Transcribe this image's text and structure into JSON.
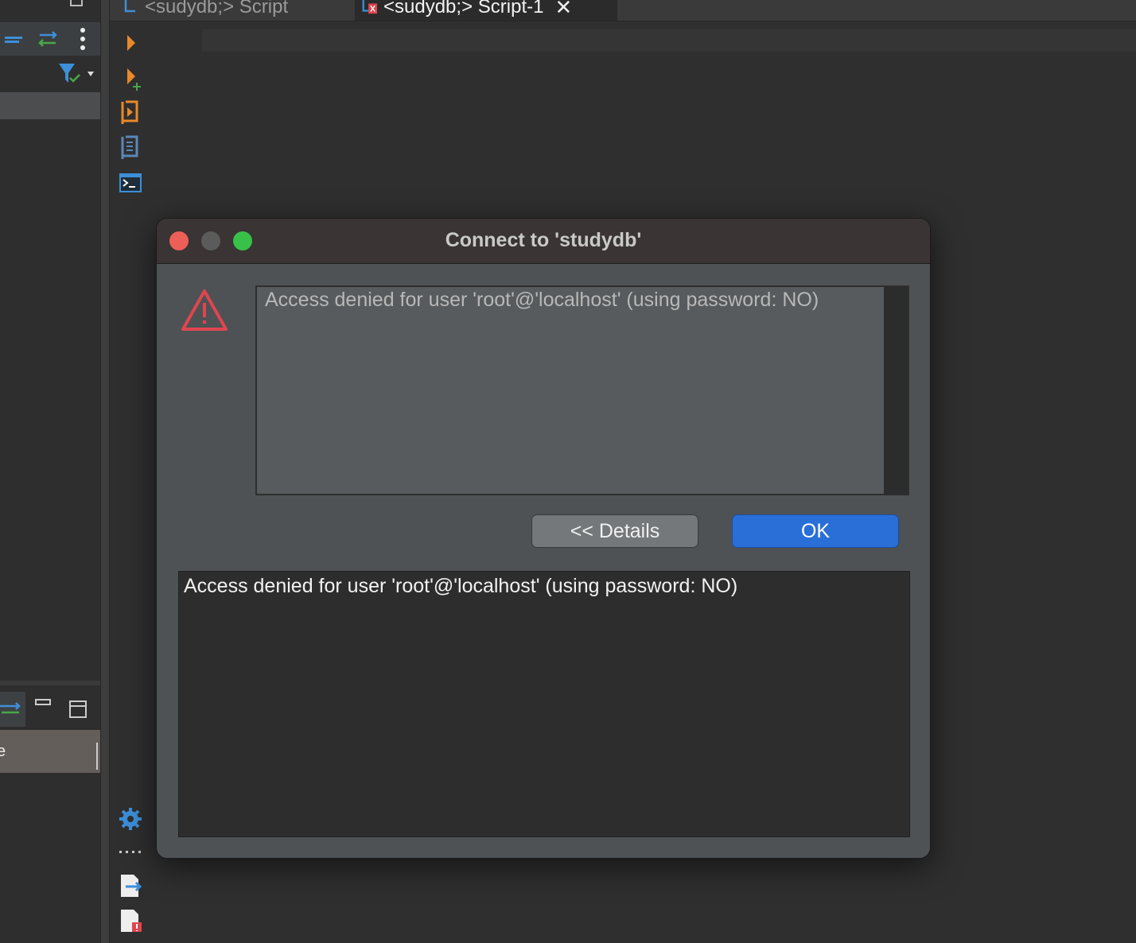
{
  "tabs": [
    {
      "label": "<sudydb;> Script",
      "active": false
    },
    {
      "label": "<sudydb;> Script-1",
      "active": true
    }
  ],
  "dialog": {
    "title": "Connect to 'studydb'",
    "message": "Access denied for user 'root'@'localhost' (using password: NO)",
    "details_button": "<< Details",
    "ok_button": "OK",
    "details_text": "Access denied for user 'root'@'localhost' (using password: NO)"
  },
  "left_panel": {
    "bottom_row_text": "e"
  },
  "icons": {
    "gutter": [
      "execute-statement-icon",
      "execute-in-new-tab-icon",
      "execute-script-icon",
      "explain-plan-icon",
      "sql-console-icon",
      "settings-icon",
      "more-icon",
      "export-icon",
      "error-log-icon"
    ]
  },
  "colors": {
    "accent": "#2a6fd8",
    "warning": "#e0454f",
    "close_red": "#ec5f57",
    "maximize_green": "#38c149"
  }
}
